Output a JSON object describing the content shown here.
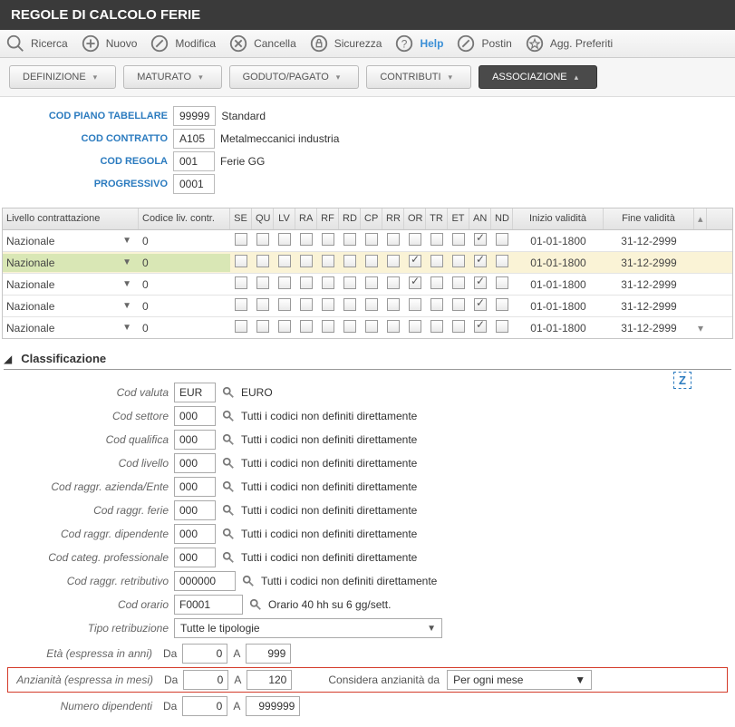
{
  "title": "REGOLE DI CALCOLO FERIE",
  "toolbar": {
    "ricerca": "Ricerca",
    "nuovo": "Nuovo",
    "modifica": "Modifica",
    "cancella": "Cancella",
    "sicurezza": "Sicurezza",
    "help": "Help",
    "postin": "Postin",
    "preferiti": "Agg. Preferiti"
  },
  "tabs": {
    "definizione": "DEFINIZIONE",
    "maturato": "MATURATO",
    "goduto": "GODUTO/PAGATO",
    "contributi": "CONTRIBUTI",
    "associazione": "ASSOCIAZIONE"
  },
  "header": {
    "piano_lbl": "COD PIANO TABELLARE",
    "piano_val": "99999",
    "piano_desc": "Standard",
    "contratto_lbl": "COD CONTRATTO",
    "contratto_val": "A105",
    "contratto_desc": "Metalmeccanici industria",
    "regola_lbl": "COD REGOLA",
    "regola_val": "001",
    "regola_desc": "Ferie GG",
    "prog_lbl": "PROGRESSIVO",
    "prog_val": "0001"
  },
  "grid": {
    "cols": {
      "liv": "Livello contrattazione",
      "cod": "Codice liv. contr.",
      "se": "SE",
      "qu": "QU",
      "lv": "LV",
      "ra": "RA",
      "rf": "RF",
      "rd": "RD",
      "cp": "CP",
      "rr": "RR",
      "or": "OR",
      "tr": "TR",
      "et": "ET",
      "an": "AN",
      "nd": "ND",
      "ini": "Inizio validità",
      "fin": "Fine validità"
    },
    "rows": [
      {
        "liv": "Nazionale",
        "cod": "0",
        "or": false,
        "an": true,
        "ini": "01-01-1800",
        "fin": "31-12-2999",
        "sel": false
      },
      {
        "liv": "Nazionale",
        "cod": "0",
        "or": true,
        "an": true,
        "ini": "01-01-1800",
        "fin": "31-12-2999",
        "sel": true
      },
      {
        "liv": "Nazionale",
        "cod": "0",
        "or": true,
        "an": true,
        "ini": "01-01-1800",
        "fin": "31-12-2999",
        "sel": false
      },
      {
        "liv": "Nazionale",
        "cod": "0",
        "or": false,
        "an": true,
        "ini": "01-01-1800",
        "fin": "31-12-2999",
        "sel": false
      },
      {
        "liv": "Nazionale",
        "cod": "0",
        "or": false,
        "an": true,
        "ini": "01-01-1800",
        "fin": "31-12-2999",
        "sel": false
      }
    ]
  },
  "section": "Classificazione",
  "form": {
    "valuta_lbl": "Cod valuta",
    "valuta_val": "EUR",
    "valuta_desc": "EURO",
    "settore_lbl": "Cod settore",
    "settore_val": "000",
    "settore_desc": "Tutti i codici non definiti direttamente",
    "qualifica_lbl": "Cod qualifica",
    "qualifica_val": "000",
    "qualifica_desc": "Tutti i codici non definiti direttamente",
    "livello_lbl": "Cod livello",
    "livello_val": "000",
    "livello_desc": "Tutti i codici non definiti direttamente",
    "azienda_lbl": "Cod raggr. azienda/Ente",
    "azienda_val": "000",
    "azienda_desc": "Tutti i codici non definiti direttamente",
    "ferie_lbl": "Cod raggr. ferie",
    "ferie_val": "000",
    "ferie_desc": "Tutti i codici non definiti direttamente",
    "dipendente_lbl": "Cod raggr. dipendente",
    "dipendente_val": "000",
    "dipendente_desc": "Tutti i codici non definiti direttamente",
    "categ_lbl": "Cod categ. professionale",
    "categ_val": "000",
    "categ_desc": "Tutti i codici non definiti direttamente",
    "retrib_lbl": "Cod raggr. retributivo",
    "retrib_val": "000000",
    "retrib_desc": "Tutti i codici non definiti direttamente",
    "orario_lbl": "Cod orario",
    "orario_val": "F0001",
    "orario_desc": "Orario 40 hh su 6 gg/sett.",
    "tiporetr_lbl": "Tipo retribuzione",
    "tiporetr_val": "Tutte le tipologie"
  },
  "ranges": {
    "eta_lbl": "Età (espressa in anni)",
    "da": "Da",
    "a": "A",
    "eta_da": "0",
    "eta_a": "999",
    "anz_lbl": "Anzianità (espressa in mesi)",
    "anz_da": "0",
    "anz_a": "120",
    "consi_lbl": "Considera anzianità da",
    "consi_val": "Per ogni mese",
    "dip_lbl": "Numero dipendenti",
    "dip_da": "0",
    "dip_a": "999999"
  },
  "z": "Z"
}
